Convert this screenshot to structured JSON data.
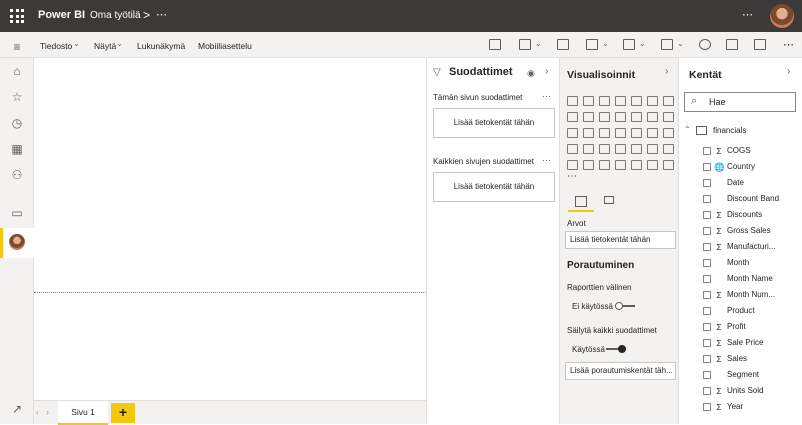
{
  "topbar": {
    "app_name": "Power BI",
    "workspace": "Oma työtilä",
    "chevron": ">",
    "more": "⋯"
  },
  "ribbon": {
    "menus": [
      "Tiedosto",
      "Näytä",
      "Lukunäkymä",
      "Mobiiliasettelu"
    ],
    "more": "⋯"
  },
  "tabs": {
    "page1": "Sivu 1",
    "add": "+"
  },
  "filters": {
    "title": "Suodattimet",
    "this_page": "Tämän sivun suodattimet",
    "all_pages": "Kaikkien sivujen suodattimet",
    "add_fields": "Lisää tietokentät tähän",
    "dots": "⋯"
  },
  "viz": {
    "title": "Visualisoinnit",
    "more": "⋯",
    "values_label": "Arvot",
    "values_well": "Lisää tietokentät tähän",
    "drill_title": "Porautuminen",
    "cross_report": "Raporttien välinen",
    "cross_report_state": "Ei käytössä",
    "keep_filters": "Säilytä kaikki suodattimet",
    "keep_filters_state": "Käytössä",
    "drill_well": "Lisää porautumiskentät täh..."
  },
  "fields": {
    "title": "Kentät",
    "search_value": "Hae",
    "table_name": "financials",
    "items": [
      {
        "name": "COGS",
        "sigma": "Σ"
      },
      {
        "name": "Country",
        "sigma": "🌐"
      },
      {
        "name": "Date",
        "sigma": ""
      },
      {
        "name": "Discount Band",
        "sigma": ""
      },
      {
        "name": "Discounts",
        "sigma": "Σ"
      },
      {
        "name": "Gross Sales",
        "sigma": "Σ"
      },
      {
        "name": "Manufacturi...",
        "sigma": "Σ"
      },
      {
        "name": "Month",
        "sigma": ""
      },
      {
        "name": "Month Name",
        "sigma": ""
      },
      {
        "name": "Month Num...",
        "sigma": "Σ"
      },
      {
        "name": "Product",
        "sigma": ""
      },
      {
        "name": "Profit",
        "sigma": "Σ"
      },
      {
        "name": "Sale Price",
        "sigma": "Σ"
      },
      {
        "name": "Sales",
        "sigma": "Σ"
      },
      {
        "name": "Segment",
        "sigma": ""
      },
      {
        "name": "Units Sold",
        "sigma": "Σ"
      },
      {
        "name": "Year",
        "sigma": "Σ"
      }
    ]
  },
  "colors": {
    "accent": "#f2c811",
    "topbar": "#3b3a39",
    "pane": "#f3f2f1"
  }
}
